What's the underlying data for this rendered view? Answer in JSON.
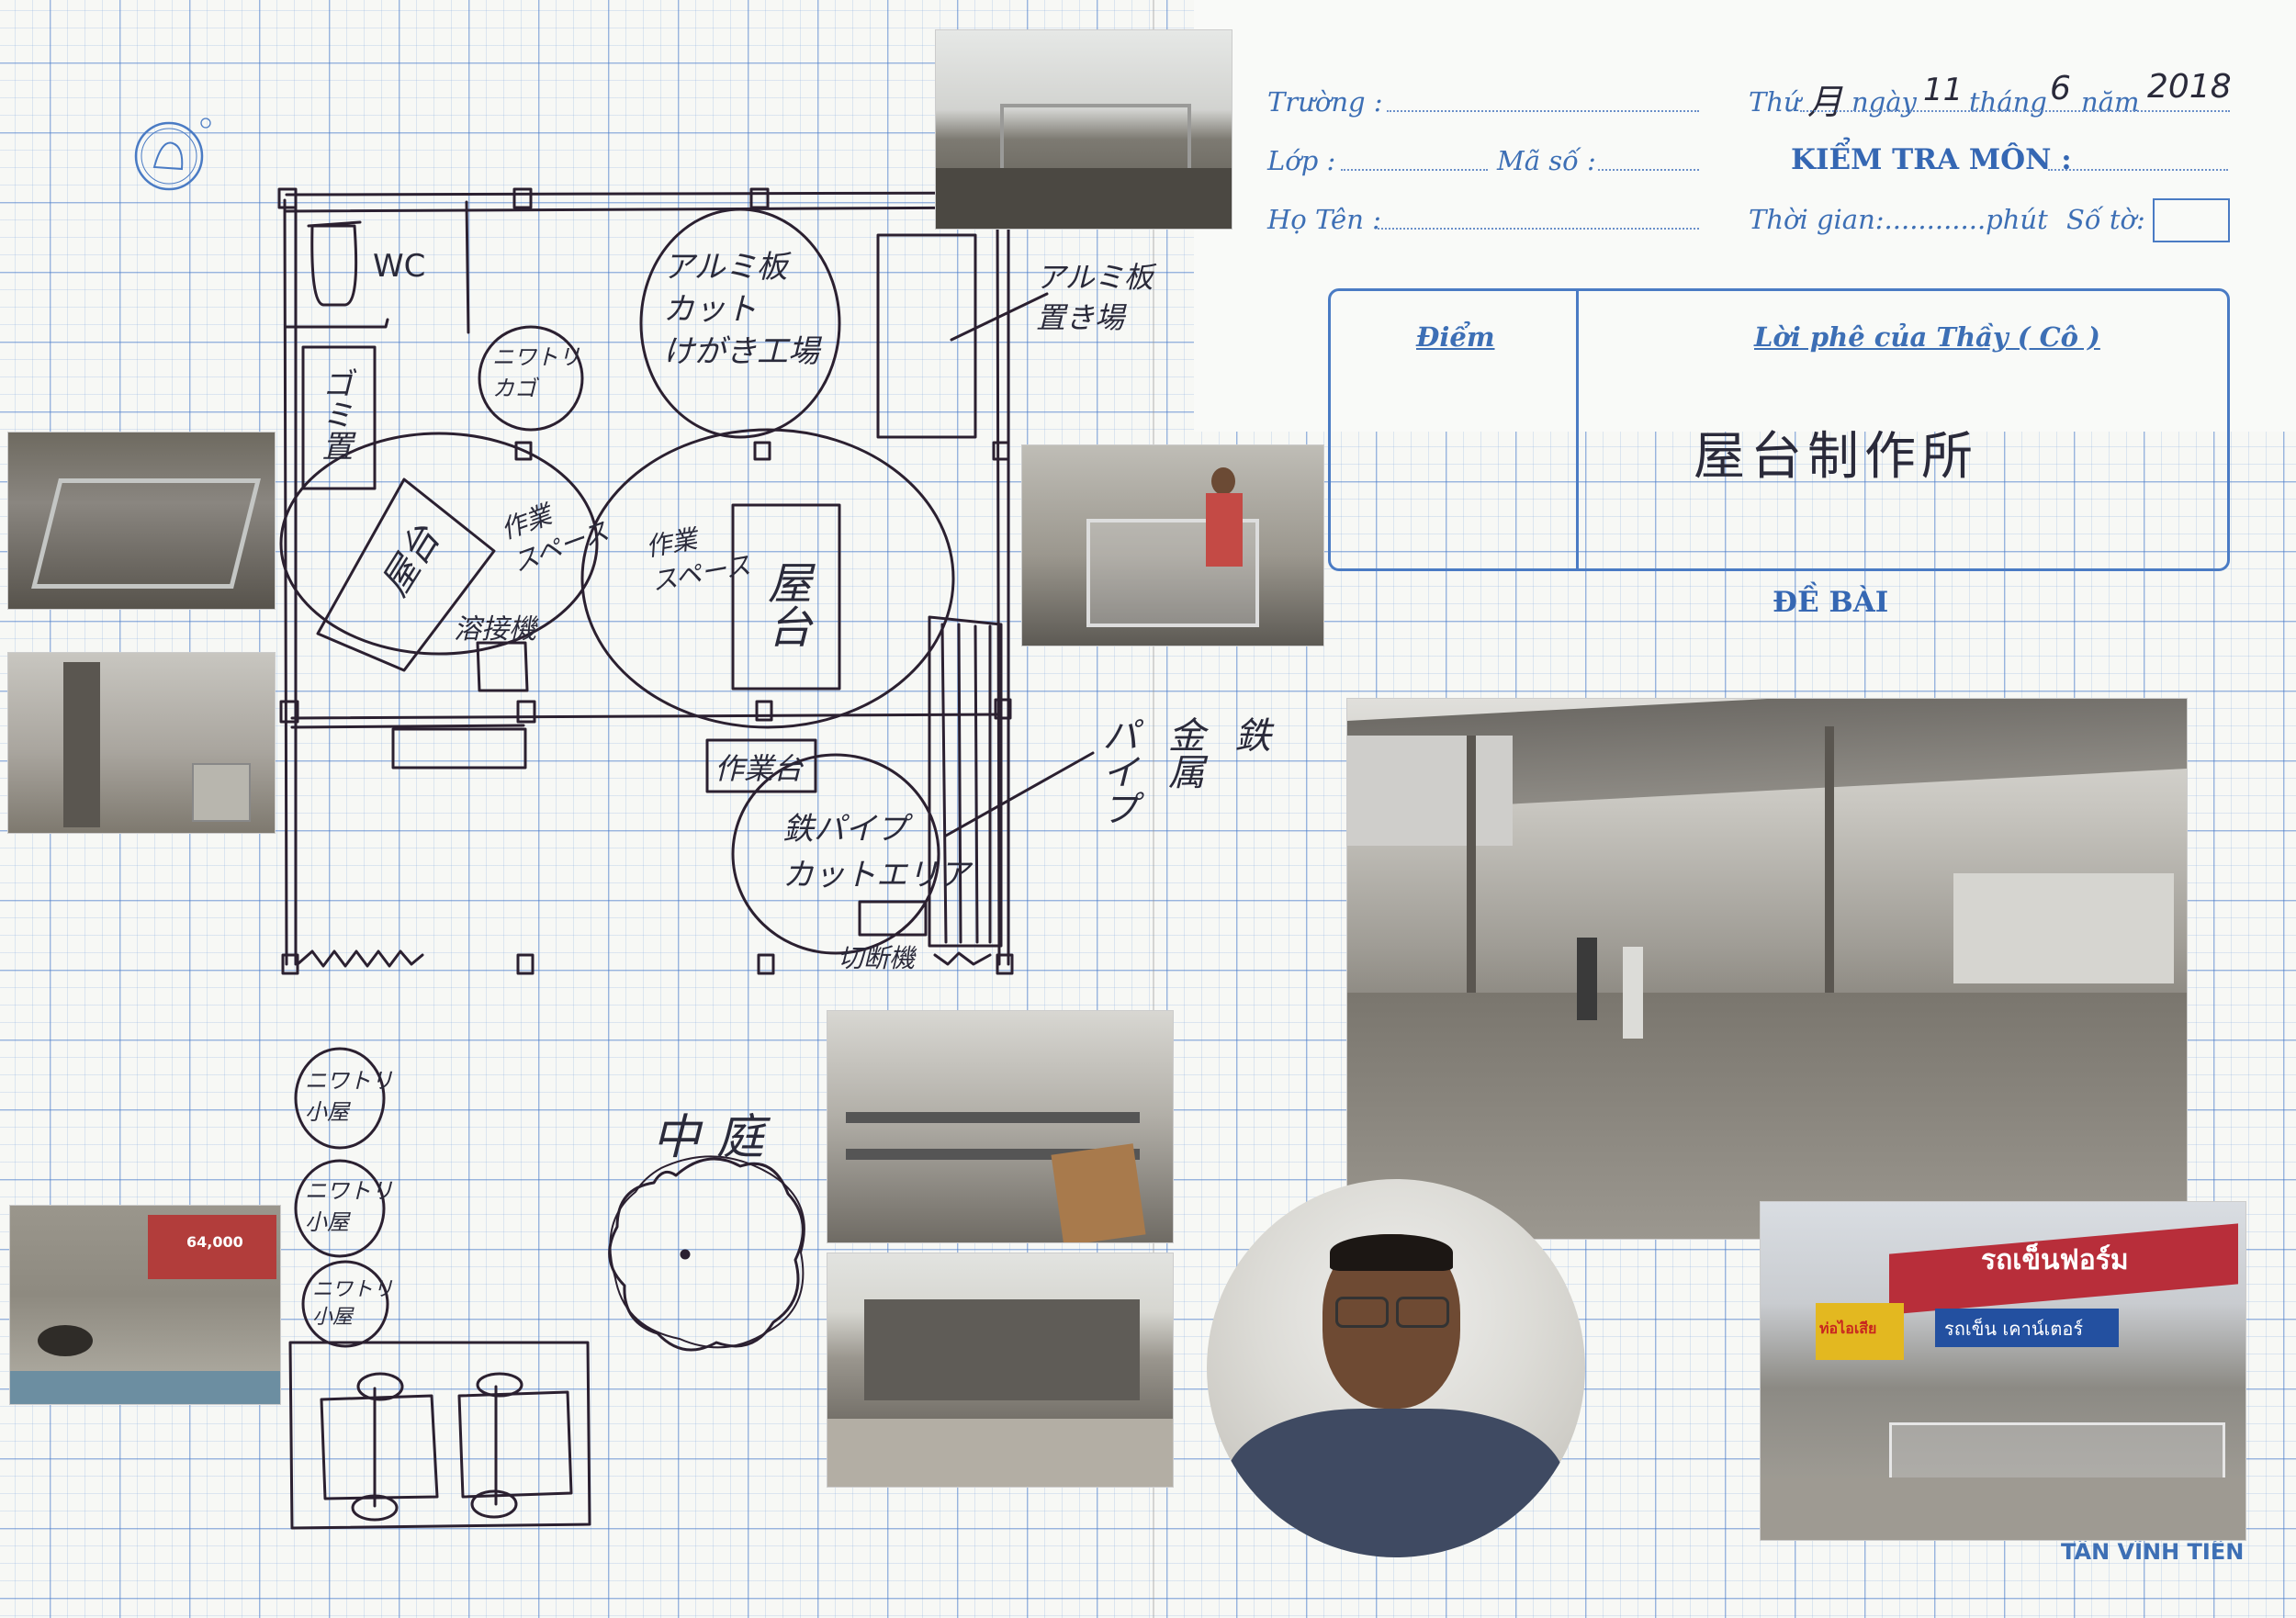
{
  "header": {
    "truong_label": "Trường :",
    "lop_label": "Lớp :",
    "ma_so_label": "Mã số :",
    "ho_ten_label": "Họ Tên :",
    "thu_label": "Thứ",
    "thu_value": "月",
    "ngay_label": "ngày",
    "ngay_value": "11",
    "thang_label": "tháng",
    "thang_value": "6",
    "nam_label": "năm",
    "nam_value": "2018",
    "kiem_tra_label": "KIỂM TRA MÔN :",
    "thoi_gian_label": "Thời gian:............phút",
    "so_to_label": "Số tờ:"
  },
  "grade_box": {
    "diem_label": "Điểm",
    "loi_phe_label": "Lời phê của Thầy ( Cô )",
    "comment": "屋台制作所"
  },
  "de_bai_label": "ĐỀ BÀI",
  "brand": "TÂN VĨNH TIẾN",
  "sketch": {
    "wc": "WC",
    "aluminum_cut": "アルミ板\nカット\nけがき工場",
    "aluminum_storage": "アルミ板\n置き場",
    "garbage": "ゴミ置",
    "chicken_cage": "ニワトリ\nカゴ",
    "yatai_left": "屋台",
    "work_space_left": "作業\nスペース",
    "welder": "溶接機",
    "work_space_right": "作業\nスペース",
    "yatai_right": "屋台",
    "workbench": "作業台",
    "pipe_cut": "鉄パイプ\nカットエリア",
    "cutter": "切断機",
    "iron_pipe": "鉄\n金属\nパイプ",
    "chicken_house_1": "ニワトリ\n小屋",
    "chicken_house_2": "ニワトリ\n小屋",
    "chicken_house_3": "ニワトリ\n小屋",
    "courtyard": "中庭"
  },
  "photo_texts": {
    "sign_red": "รถเข็นฟอร์ม",
    "sign_blue": "รถเข็น เคาน์เตอร์",
    "sign_yellow": "ท่อไอเสีย",
    "price": "64,000"
  }
}
